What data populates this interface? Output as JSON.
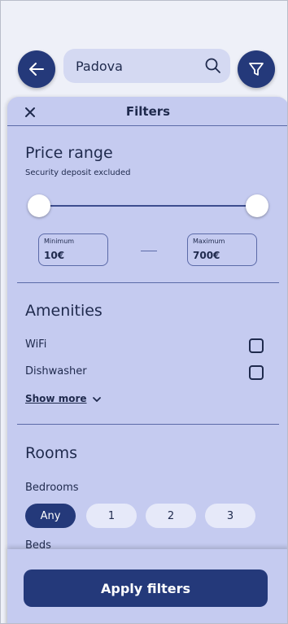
{
  "search": {
    "query": "Padova"
  },
  "filters": {
    "title": "Filters",
    "price": {
      "title": "Price range",
      "subtitle": "Security deposit excluded",
      "min_label": "Minimum",
      "min_value": "10€",
      "max_label": "Maximum",
      "max_value": "700€",
      "range_fraction": [
        0.0,
        1.0
      ]
    },
    "amenities": {
      "title": "Amenities",
      "items": [
        {
          "label": "WiFi",
          "checked": false
        },
        {
          "label": "Dishwasher",
          "checked": false
        }
      ],
      "show_more": "Show more"
    },
    "rooms": {
      "title": "Rooms",
      "bedrooms_label": "Bedrooms",
      "options": [
        "Any",
        "1",
        "2",
        "3"
      ],
      "selected": "Any",
      "beds_label": "Beds"
    },
    "apply_label": "Apply filters"
  },
  "colors": {
    "primary": "#24397a",
    "sheet": "#c5cbf0",
    "search_bg": "#d4d9f2",
    "chip_bg": "#e6e9f9"
  },
  "icons": [
    "arrow-left-icon",
    "search-icon",
    "filter-icon",
    "close-icon",
    "chevron-down-icon"
  ]
}
